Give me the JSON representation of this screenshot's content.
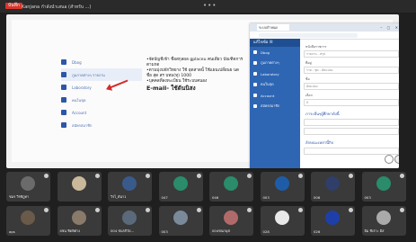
{
  "topbar": {
    "rec_label": "บันทึก",
    "share_title": "Kanjana กำลังนำเสนอ (สำหรับ ...)",
    "menu_dots": "•••"
  },
  "slide": {
    "menu": [
      "Dbog",
      "ภูมภาคต่างๆ รายงาน",
      "Laboratory",
      "คนในชุด",
      "Account",
      "สมัครสมาชิก"
    ],
    "bullets": [
      "•จัดบัญชีเข้า ชื่อสกุลผล gplaceu คนเดียว บัณฑิตการ ตามกด",
      "•ตามมุ่งบพักวิทยาง ใช้ อุดสาดนั้ ใช้แผนเปลี่ยนย นด ชื่อ สุด สร บทม(ทุ) 1000",
      "•บุคคลที่ลงทะเบียน ใช้ระบบคนอง"
    ],
    "big_line": "E-mail- ใช้ต้นนิสง"
  },
  "panel": {
    "tab_label": "ระบบกำหนด",
    "window_controls": "– ▢ ✕",
    "brand": "แก้ไขข้อ ☰",
    "side_items": [
      "Dbog",
      "ภูมภาคต่างๆ",
      "Laboratory",
      "คนในชุด",
      "Account",
      "สมัครสมาชิก"
    ],
    "form_labels": [
      "หนังสือราชการ",
      "ที่อยู่",
      "ชื่อ",
      "เลือก"
    ],
    "form_values": [
      "รายงาน - สรุป",
      "ราย - ชุด - ดัดแปลง",
      "ดัดแปลง",
      "0"
    ],
    "section1": "ภาระอื่นๆผู้ศึกษาดังนี้",
    "section2": "ลักษณะเหล่านี้กิจ"
  },
  "participants": [
    {
      "name": "ชมร วีรทิฎทา",
      "color": "#6b6b6b"
    },
    {
      "name": "",
      "color": "#c9b89a"
    },
    {
      "name": "วิรไ_ตันา1",
      "color": "#3a5a8c"
    },
    {
      "name": "047",
      "color": "#2a8c6a"
    },
    {
      "name": "046",
      "color": "#2a8c6a"
    },
    {
      "name": "003",
      "color": "#1f5ca8"
    },
    {
      "name": "006",
      "color": "#2f3f6a"
    },
    {
      "name": "003",
      "color": "#2a8c6a"
    },
    {
      "name": "aps",
      "color": "#6a5a4a"
    },
    {
      "name": "ยชน ชิดพิศาง",
      "color": "#8a7a6a"
    },
    {
      "name": "004 ชนรภิวัย...",
      "color": "#5a6a7a"
    },
    {
      "name": "003",
      "color": "#7a8a9a"
    },
    {
      "name": "004ชนกนุช",
      "color": "#b06a6a"
    },
    {
      "name": "028",
      "color": "#e8e8e8"
    },
    {
      "name": "026",
      "color": "#1f3fa8"
    },
    {
      "name": "อิม ชิเราะ อิส",
      "color": "#aaaaaa"
    }
  ]
}
